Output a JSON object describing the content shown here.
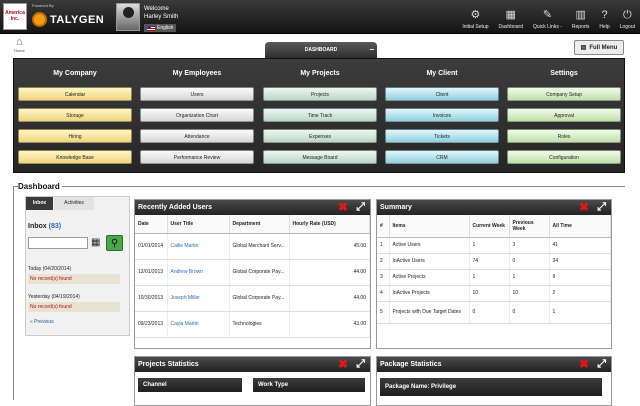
{
  "header": {
    "logo_text": "America Inc.",
    "powered_by": "Powered By",
    "brand": "TALYGEN",
    "welcome": "Welcome",
    "user_name": "Harley Smith",
    "language": "English",
    "nav": [
      {
        "label": "Initial Setup",
        "icon": "gear-icon",
        "glyph": "⚙"
      },
      {
        "label": "Dashboard",
        "icon": "dashboard-icon",
        "glyph": "▦"
      },
      {
        "label": "Quick Links -",
        "icon": "link-icon",
        "glyph": "✎"
      },
      {
        "label": "Reports",
        "icon": "chart-icon",
        "glyph": "▥"
      },
      {
        "label": "Help",
        "icon": "help-icon",
        "glyph": "?"
      },
      {
        "label": "Logout",
        "icon": "power-icon",
        "glyph": "⏻"
      }
    ]
  },
  "home": {
    "label": "Home"
  },
  "dashboard_tab": {
    "label": "DASHBOARD",
    "toggle": "−"
  },
  "full_menu": {
    "label": "Full Menu"
  },
  "menu": {
    "columns": [
      {
        "title": "My Company",
        "items": [
          "Calendar",
          "Storage",
          "Hiring",
          "Knowledge Base"
        ]
      },
      {
        "title": "My Employees",
        "items": [
          "Users",
          "Organization Chart",
          "Attendance",
          "Performance Review"
        ]
      },
      {
        "title": "My Projects",
        "items": [
          "Projects",
          "Time Track",
          "Expenses",
          "Message Board"
        ]
      },
      {
        "title": "My Client",
        "items": [
          "Client",
          "Invoices",
          "Tickets",
          "CRM"
        ]
      },
      {
        "title": "Settings",
        "items": [
          "Company Setup",
          "Approval",
          "Roles",
          "Configuration"
        ]
      }
    ]
  },
  "dashboard": {
    "title": "Dashboard"
  },
  "inbox": {
    "tabs": [
      "Inbox",
      "Activities"
    ],
    "title": "Inbox",
    "count": "(83)",
    "today": "Today (04/20/2014)",
    "yesterday": "Yesterday (04/19/2014)",
    "no_records": "No record(s) found",
    "previous": "« Previous"
  },
  "recent_users": {
    "title": "Recently Added Users",
    "columns": [
      "Date",
      "User Title",
      "Department",
      "Hourly Rate (USD)"
    ],
    "rows": [
      {
        "date": "01/01/2014",
        "user": "Callie Martin",
        "dept": "Global Merchant Serv...",
        "rate": "45.00"
      },
      {
        "date": "12/01/2013",
        "user": "Andrew Brown",
        "dept": "Global Corporate Pay...",
        "rate": "44.00"
      },
      {
        "date": "10/30/2013",
        "user": "Joseph Miller",
        "dept": "Global Corporate Pay...",
        "rate": "44.00"
      },
      {
        "date": "09/23/2013",
        "user": "Cayla Martin",
        "dept": "Technologies",
        "rate": "43.00"
      }
    ]
  },
  "summary": {
    "title": "Summary",
    "columns": [
      "#",
      "Items",
      "Current Week",
      "Previous Week",
      "All Time"
    ],
    "rows": [
      {
        "n": "1",
        "item": "Active Users",
        "cur": "1",
        "prev": "3",
        "all": "41"
      },
      {
        "n": "2",
        "item": "InActive Users",
        "cur": "74",
        "prev": "0",
        "all": "34"
      },
      {
        "n": "3",
        "item": "Active Projects",
        "cur": "1",
        "prev": "1",
        "all": "9"
      },
      {
        "n": "4",
        "item": "InActive Projects",
        "cur": "10",
        "prev": "10",
        "all": "2"
      },
      {
        "n": "5",
        "item": "Projects with Due Target Dates",
        "cur": "0",
        "prev": "0",
        "all": "1"
      }
    ]
  },
  "projects_stats": {
    "title": "Projects Statistics",
    "col1": "Channel",
    "col2": "Work Type"
  },
  "package_stats": {
    "title": "Package Statistics",
    "package_name": "Package Name: Privilege"
  }
}
